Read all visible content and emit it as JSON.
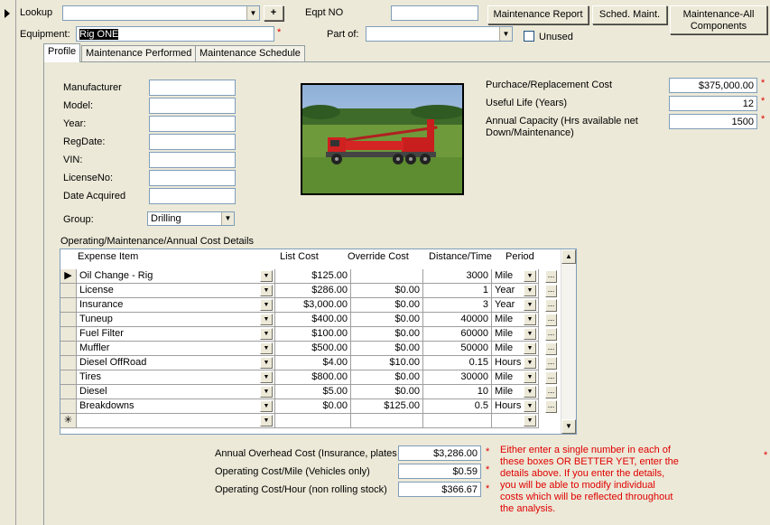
{
  "header": {
    "lookup_label": "Lookup",
    "lookup_value": "",
    "lookup_add": "+",
    "eqpt_no_label": "Eqpt NO",
    "eqpt_no_value": "",
    "maintenance_report_button": "Maintenance Report",
    "sched_maint_button": "Sched. Maint.",
    "maintenance_all_button": "Maintenance-All Components",
    "equipment_label": "Equipment:",
    "equipment_value": "Rig ONE",
    "part_of_label": "Part of:",
    "part_of_value": "",
    "unused_label": "Unused"
  },
  "tabs": [
    {
      "label": "Profile"
    },
    {
      "label": "Maintenance Performed"
    },
    {
      "label": "Maintenance Schedule"
    }
  ],
  "profile": {
    "fields": [
      {
        "label": "Manufacturer",
        "value": ""
      },
      {
        "label": "Model:",
        "value": ""
      },
      {
        "label": "Year:",
        "value": ""
      },
      {
        "label": "RegDate:",
        "value": ""
      },
      {
        "label": "VIN:",
        "value": ""
      },
      {
        "label": "LicenseNo:",
        "value": ""
      },
      {
        "label": "Date Acquired",
        "value": ""
      }
    ],
    "group_label": "Group:",
    "group_value": "Drilling"
  },
  "costs": {
    "purchase_label": "Purchace/Replacement Cost",
    "purchase_value": "$375,000.00",
    "useful_life_label": "Useful Life (Years)",
    "useful_life_value": "12",
    "annual_capacity_label_1": "Annual Capacity (Hrs available net",
    "annual_capacity_label_2": "Down/Maintenance)",
    "annual_capacity_value": "1500"
  },
  "details": {
    "section_title": "Operating/Maintenance/Annual Cost Details",
    "columns": [
      "Expense Item",
      "List Cost",
      "Override Cost",
      "Distance/Time",
      "Period"
    ],
    "rows": [
      {
        "item": "Oil Change - Rig",
        "list": "$125.00",
        "override": "",
        "distance": "3000",
        "period": "Mile"
      },
      {
        "item": "License",
        "list": "$286.00",
        "override": "$0.00",
        "distance": "1",
        "period": "Year"
      },
      {
        "item": "Insurance",
        "list": "$3,000.00",
        "override": "$0.00",
        "distance": "3",
        "period": "Year"
      },
      {
        "item": "Tuneup",
        "list": "$400.00",
        "override": "$0.00",
        "distance": "40000",
        "period": "Mile"
      },
      {
        "item": "Fuel Filter",
        "list": "$100.00",
        "override": "$0.00",
        "distance": "60000",
        "period": "Mile"
      },
      {
        "item": "Muffler",
        "list": "$500.00",
        "override": "$0.00",
        "distance": "50000",
        "period": "Mile"
      },
      {
        "item": "Diesel OffRoad",
        "list": "$4.00",
        "override": "$10.00",
        "distance": "0.15",
        "period": "Hours"
      },
      {
        "item": "Tires",
        "list": "$800.00",
        "override": "$0.00",
        "distance": "30000",
        "period": "Mile"
      },
      {
        "item": "Diesel",
        "list": "$5.00",
        "override": "$0.00",
        "distance": "10",
        "period": "Mile"
      },
      {
        "item": "Breakdowns",
        "list": "$0.00",
        "override": "$125.00",
        "distance": "0.5",
        "period": "Hours"
      }
    ],
    "new_row_marker": "✳",
    "row_button": "..."
  },
  "summary": {
    "overhead_label": "Annual Overhead Cost (Insurance, plates",
    "overhead_value": "$3,286.00",
    "per_mile_label": "Operating Cost/Mile (Vehicles only)",
    "per_mile_value": "$0.59",
    "per_hour_label": "Operating Cost/Hour (non rolling stock)",
    "per_hour_value": "$366.67",
    "note": "Either enter a single number in each of these boxes OR BETTER YET, enter the details above.  If you enter the details, you will be able to modify individual costs which will be reflected throughout the analysis."
  },
  "colors": {
    "required": "#E00000",
    "form_bg": "#ECE9D8",
    "field_border": "#7F9DB9"
  }
}
